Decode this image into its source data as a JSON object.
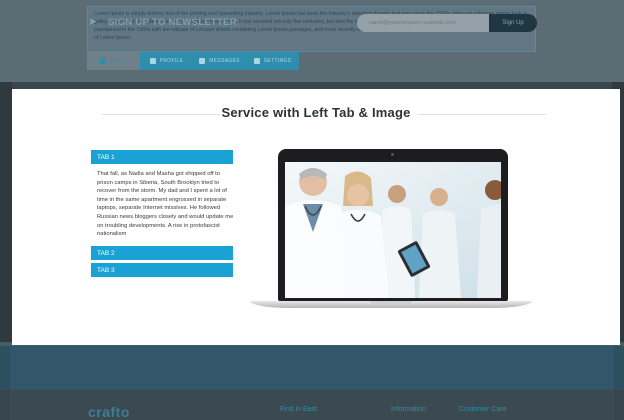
{
  "background_page": {
    "intro_text": "Lorem Ipsum is simply dummy text of the printing and typesetting industry. Lorem Ipsum has been the industry's standard dummy text ever since the 1500s, when an unknown printer took a galley of type and scrambled it to make a type specimen book. It has survived not only five centuries, but also the leap into electronic typesetting, remaining essentially unchanged. It was popularised in the 1960s with the release of Letraset sheets containing Lorem Ipsum passages, and more recently with desktop publishing software like Aldus PageMaker including versions of Lorem Ipsum.",
    "tabs": [
      {
        "label": "HOME",
        "icon": "home-icon",
        "active": true
      },
      {
        "label": "PROFILE",
        "icon": "user-icon",
        "active": false
      },
      {
        "label": "MESSAGES",
        "icon": "messages-icon",
        "active": false
      },
      {
        "label": "SETTINGS",
        "icon": "gear-icon",
        "active": false
      }
    ],
    "newsletter": {
      "label": "SIGN UP TO NEWSLETTER",
      "input_placeholder": "name@yourcompany-example.com",
      "button_label": "Sign Up"
    },
    "footer": {
      "logo": "crafto",
      "columns": [
        "Find in East",
        "Information",
        "Customer Care"
      ]
    }
  },
  "modal": {
    "title": "Service  with Left Tab & Image",
    "tabs": [
      {
        "label": "TAB 1",
        "active": true
      },
      {
        "label": "TAB 2",
        "active": false
      },
      {
        "label": "TAB 3",
        "active": false
      }
    ],
    "active_tab_content": "That fall, as Nadia and Masha got shipped off to prison camps in Siberia, South Brooklyn tried to recover from the storm. My dad and I spent a lot of time in the same apartment engrossed in separate laptops, separate Internet missives. He followed Russian news bloggers closely and would update me on troubling developments. A rise in protofascist nationalism",
    "image": "laptop-doctors-image"
  },
  "colors": {
    "accent": "#1aa2d4",
    "title": "#2a3338",
    "overlay": "#4b5a63"
  }
}
